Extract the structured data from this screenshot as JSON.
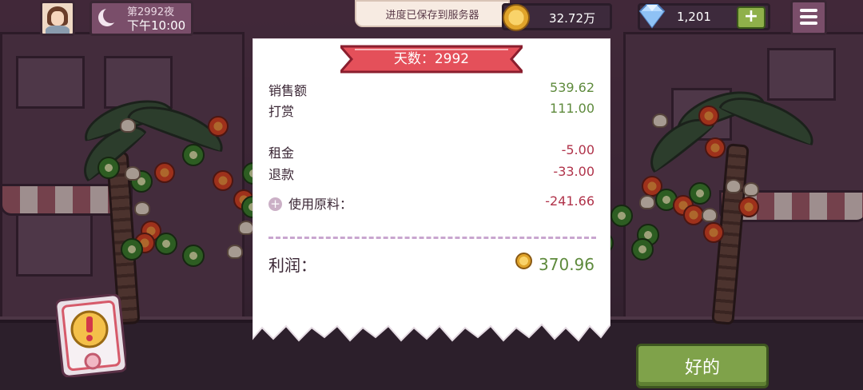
{
  "hud": {
    "day_label": "第2992夜",
    "time_label": "下午10:00",
    "toast": "进度已保存到服务器",
    "coins": "32.72万",
    "gems": "1,201",
    "plus": "+"
  },
  "receipt": {
    "title": "天数：2992",
    "rows": [
      {
        "label": "销售额",
        "value": "539.62"
      },
      {
        "label": "打赏",
        "value": "111.00"
      },
      {
        "label": "租金",
        "value": "-5.00"
      },
      {
        "label": "退款",
        "value": "-33.00"
      },
      {
        "label": "使用原料：",
        "value": "-241.66"
      }
    ],
    "profit_label": "利润：",
    "profit_value": "370.96"
  },
  "buttons": {
    "ok": "好的"
  },
  "colors": {
    "positive": "#5e8a3c",
    "negative": "#b0334a",
    "ribbon": "#e4505a",
    "ok_button": "#7fa24a"
  },
  "icons": [
    "moon-icon",
    "coin-icon",
    "gem-icon",
    "plus-icon",
    "menu-icon",
    "alert-icon"
  ]
}
